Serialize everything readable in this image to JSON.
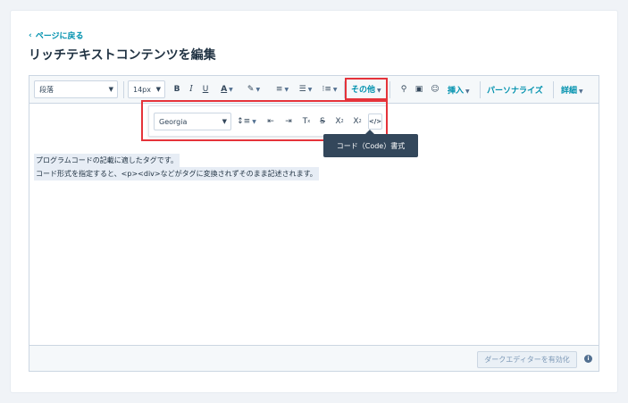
{
  "back_link": "ページに戻る",
  "page_title": "リッチテキストコンテンツを編集",
  "toolbar": {
    "paragraph_select": "段落",
    "font_size_select": "14px",
    "bold": "B",
    "italic": "I",
    "underline": "U",
    "font_color": "A",
    "other_label": "その他",
    "insert_label": "挿入",
    "personalize_label": "パーソナライズ",
    "details_label": "詳細"
  },
  "popup": {
    "font_select": "Georgia",
    "clear_format": "T",
    "superscript": "X",
    "subscript": "X",
    "code_button": "</>"
  },
  "tooltip": "コード（Code）書式",
  "content": {
    "line1": "プログラムコードの記載に適したタグです。",
    "line2": "コード形式を指定すると、<p><div>などがタグに変換されずそのまま記述されます。"
  },
  "footer": {
    "dark_editor_button": "ダークエディターを有効化",
    "info_icon": "i"
  },
  "colors": {
    "accent": "#0091ae",
    "highlight_border": "#e5333a",
    "tooltip_bg": "#33475b"
  }
}
